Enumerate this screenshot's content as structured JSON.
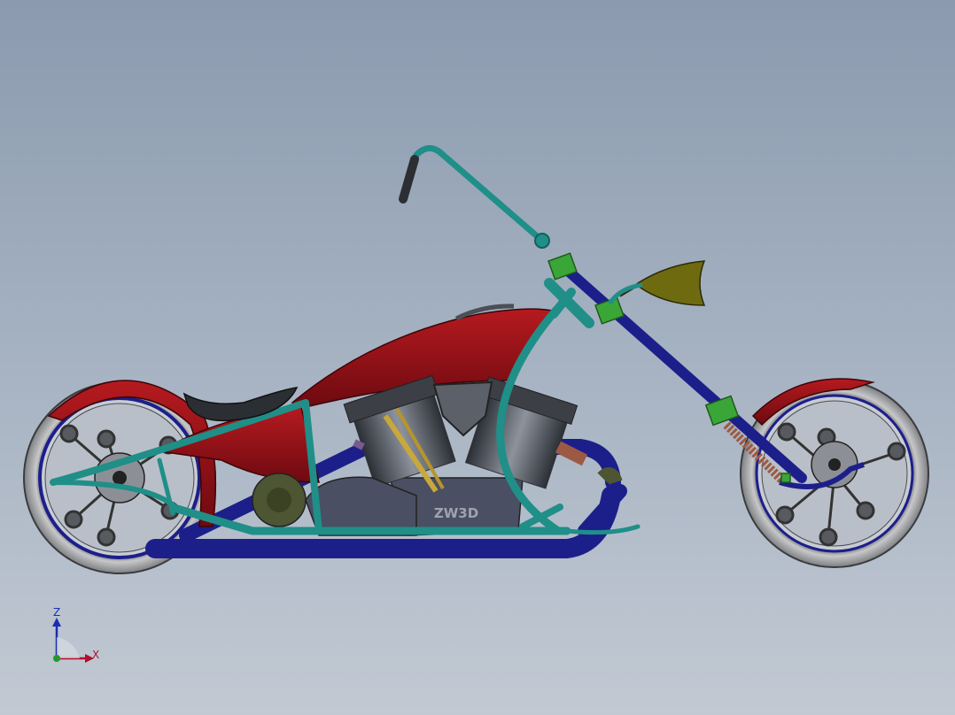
{
  "viewport": {
    "background_top": "#8b9aaf",
    "background_bottom": "#c2c9d3"
  },
  "model": {
    "engine_logo_text": "ZW3D",
    "colors": {
      "frame_teal": "#1f8f88",
      "frame_navy": "#1c1f8a",
      "fender_red": "#8a0f14",
      "clamp_green": "#3aa637",
      "headlight_olive": "#6e6a10",
      "engine_slate": "#4a4f63",
      "tire_gray": "#a6a6a8",
      "seat_dark": "#2b2f33",
      "spring_copper": "#9c5a44"
    }
  },
  "triad": {
    "z_label": "Z",
    "x_label": "X",
    "z_color": "#1a2fb0",
    "x_color": "#b0102a",
    "y_color": "#1f9a2c"
  }
}
